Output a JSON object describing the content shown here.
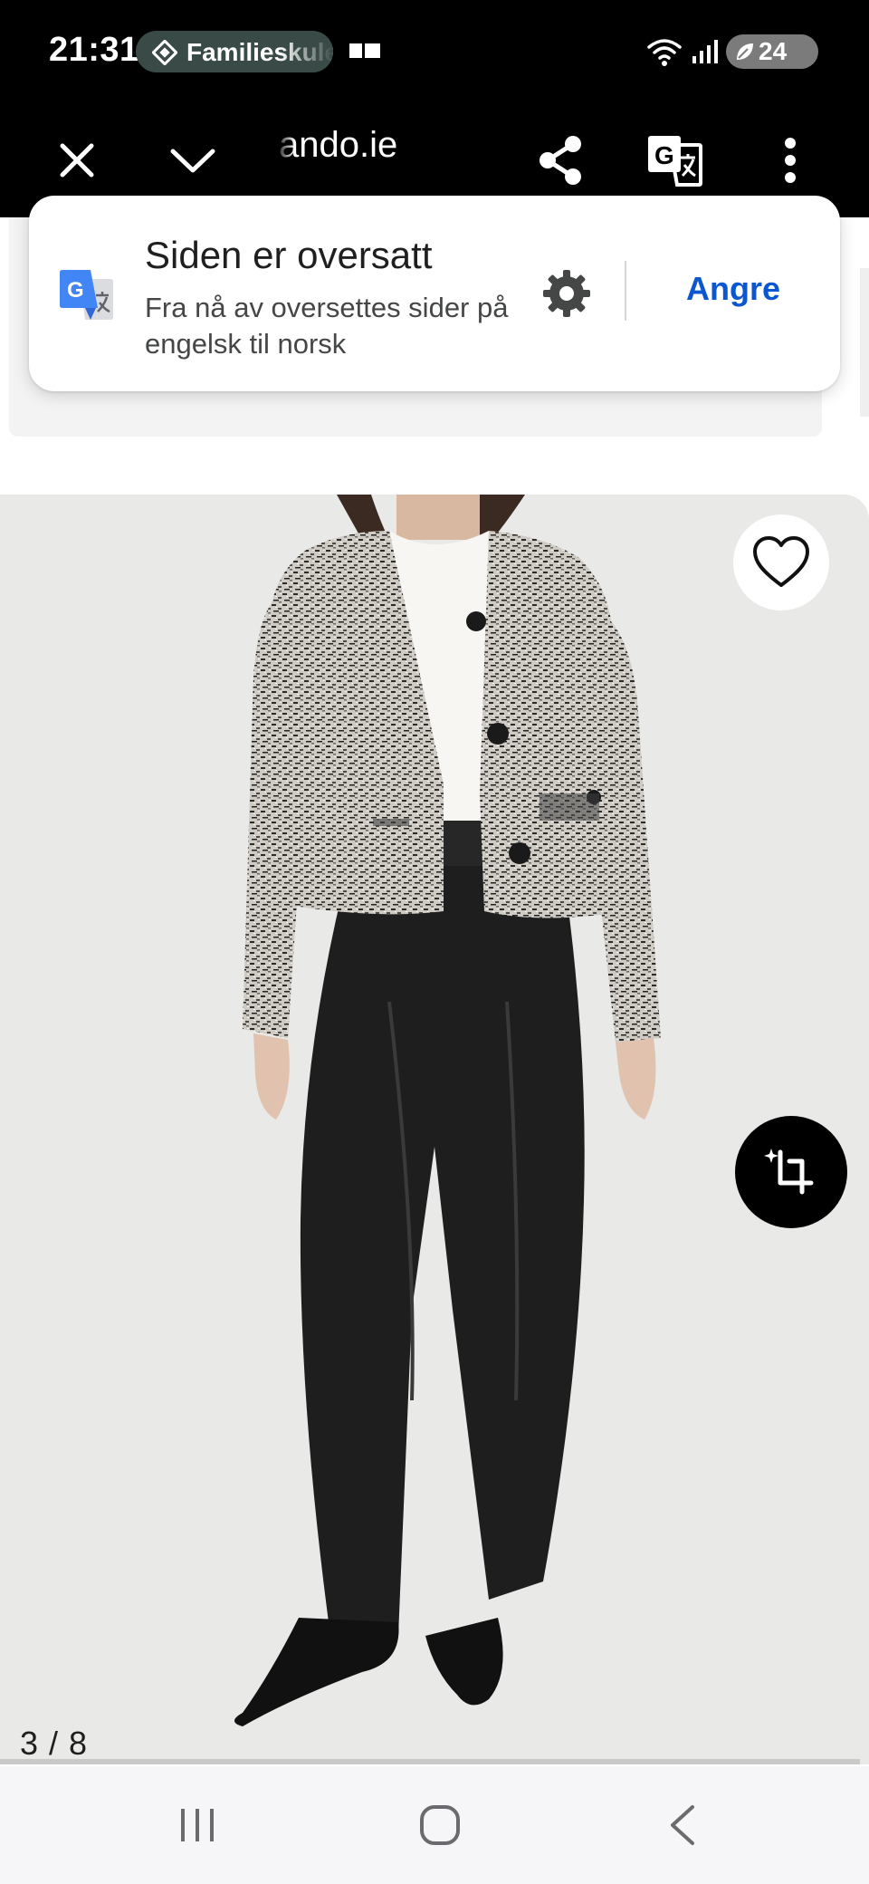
{
  "status_bar": {
    "time": "21:31",
    "notification_pill": "Familieskule",
    "battery": "24",
    "icons": [
      "diamond-icon",
      "media-icon",
      "wifi-icon",
      "signal-icon",
      "battery-icon"
    ]
  },
  "toolbar": {
    "url": "ando.ie",
    "icons": [
      "close-icon",
      "chevron-down-icon",
      "share-icon",
      "translate-icon",
      "more-vert-icon"
    ]
  },
  "translate_card": {
    "title": "Siden er oversatt",
    "subtitle": "Fra nå av oversettes sider på engelsk til norsk",
    "undo_label": "Angre",
    "icons": [
      "google-translate-icon",
      "gear-icon"
    ],
    "accent_color": "#0b57d0"
  },
  "product": {
    "page_counter": "3 / 8",
    "icons": [
      "heart-icon",
      "crop-icon"
    ]
  },
  "nav_bar": {
    "icons": [
      "recents-icon",
      "home-icon",
      "back-icon"
    ]
  }
}
